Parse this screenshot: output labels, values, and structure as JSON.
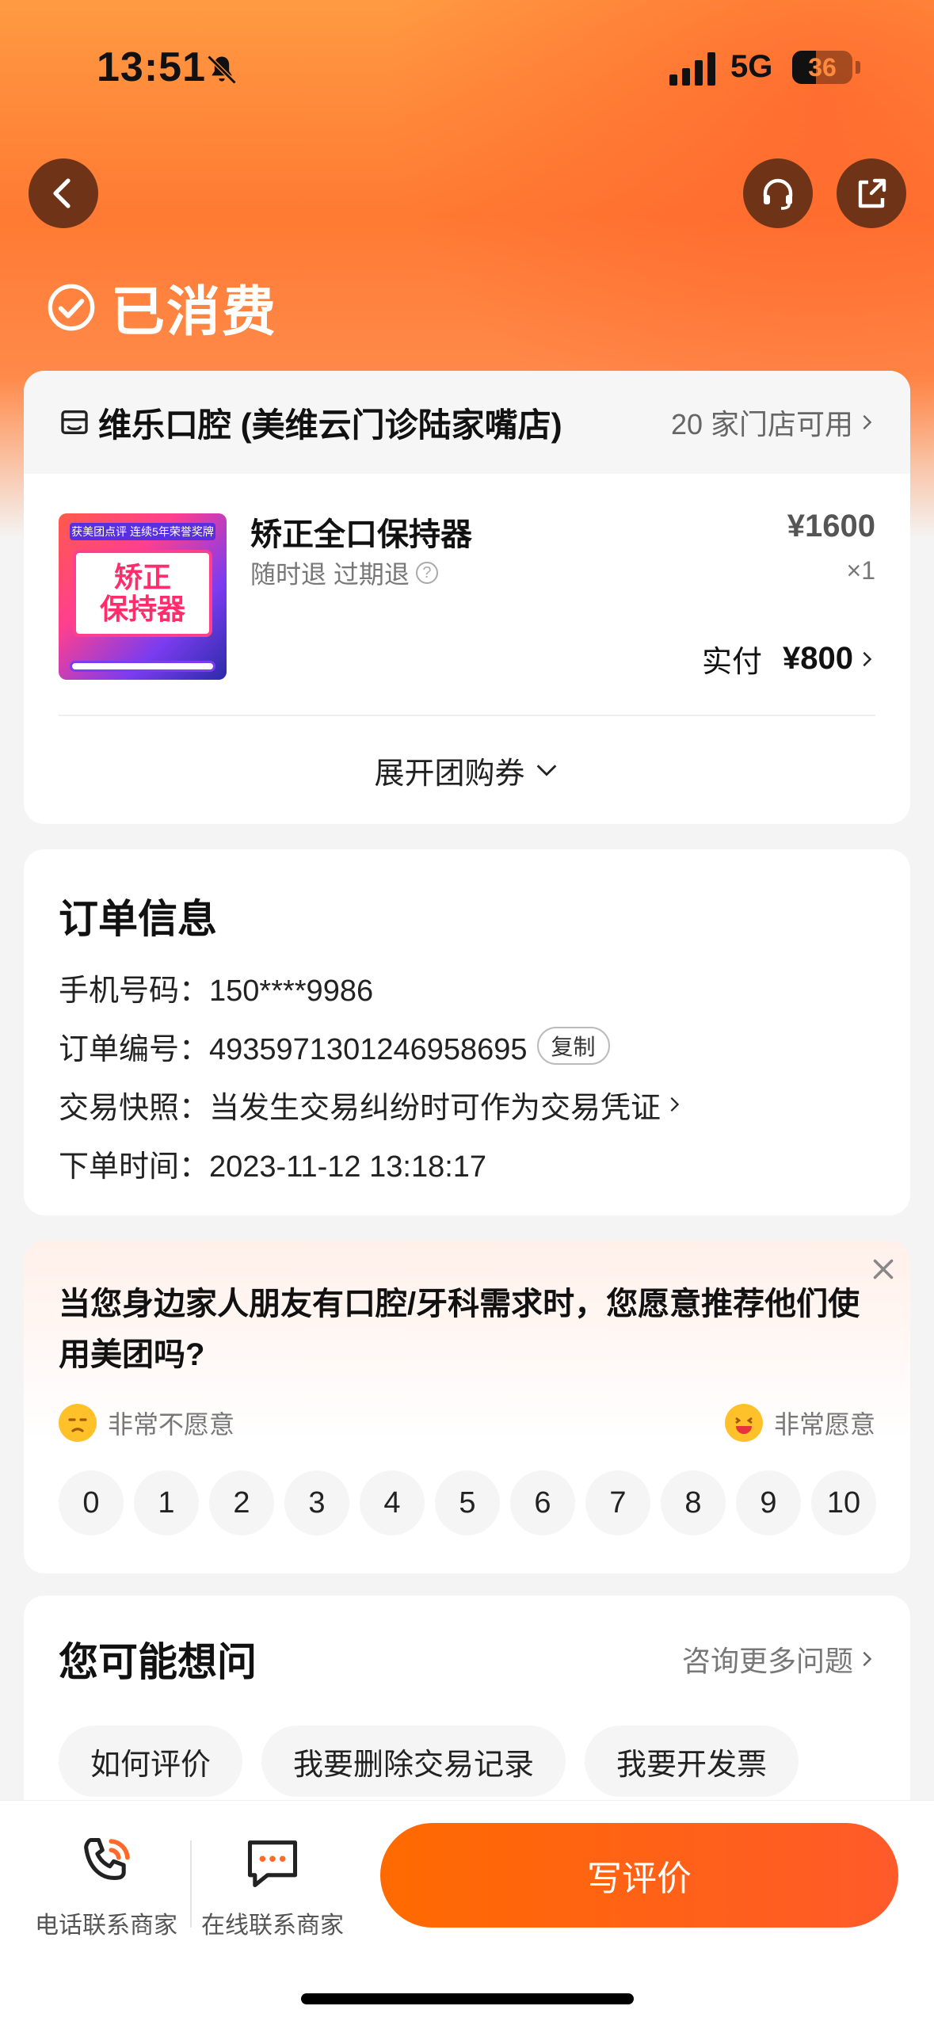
{
  "status_bar": {
    "time": "13:51",
    "network": "5G",
    "battery": "36"
  },
  "nav": {
    "back_icon": "back-arrow-icon",
    "support_icon": "headset-icon",
    "share_icon": "share-icon"
  },
  "order_status": {
    "label": "已消费"
  },
  "shop": {
    "name": "维乐口腔 (美维云门诊陆家嘴店)",
    "availability": "20 家门店可用"
  },
  "product": {
    "image_banner": "获美团点评 连续5年荣誉奖牌",
    "image_line1": "矫正",
    "image_line2": "保持器",
    "title": "矫正全口保持器",
    "refund_policy": "随时退 过期退",
    "price": "¥1600",
    "quantity": "×1",
    "paid_label": "实付",
    "paid_amount": "¥800",
    "expand_label": "展开团购券"
  },
  "order_info": {
    "title": "订单信息",
    "phone": "手机号码：150****9986",
    "order_no": "订单编号：4935971301246958695",
    "copy_label": "复制",
    "snapshot": "交易快照：当发生交易纠纷时可作为交易凭证",
    "time": "下单时间：2023-11-12 13:18:17"
  },
  "nps": {
    "question": "当您身边家人朋友有口腔/牙科需求时，您愿意推荐他们使用美团吗?",
    "low_label": "非常不愿意",
    "high_label": "非常愿意",
    "scale": [
      "0",
      "1",
      "2",
      "3",
      "4",
      "5",
      "6",
      "7",
      "8",
      "9",
      "10"
    ]
  },
  "faq": {
    "title": "您可能想问",
    "more": "咨询更多问题",
    "chips": [
      "如何评价",
      "我要删除交易记录",
      "我要开发票"
    ]
  },
  "bottom_bar": {
    "phone_label": "电话联系商家",
    "chat_label": "在线联系商家",
    "review_button": "写评价"
  },
  "colors": {
    "accent": "#ff6a00",
    "header_orange": "#ff7a33",
    "icon_button_bg": "#6f3417"
  }
}
